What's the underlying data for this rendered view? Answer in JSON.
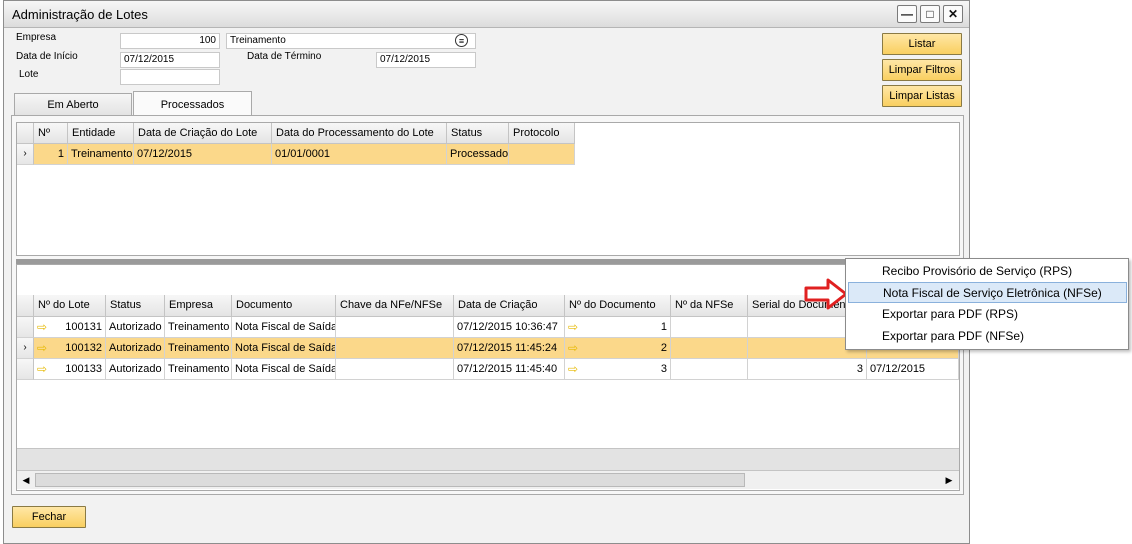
{
  "window": {
    "title": "Administração de Lotes",
    "controls": {
      "minimize": "—",
      "maximize": "□",
      "close": "✕"
    }
  },
  "form": {
    "empresa_label": "Empresa",
    "empresa_value": "100",
    "empresa_name": "Treinamento",
    "data_inicio_label": "Data de Início",
    "data_inicio_value": "07/12/2015",
    "data_termino_label": "Data de Término",
    "data_termino_value": "07/12/2015",
    "lote_label": "Lote",
    "lote_value": ""
  },
  "buttons": {
    "listar": "Listar",
    "limpar_filtros": "Limpar Filtros",
    "limpar_listas": "Limpar Listas",
    "fechar": "Fechar"
  },
  "tabs": [
    {
      "label": "Em Aberto",
      "active": false
    },
    {
      "label": "Processados",
      "active": true
    }
  ],
  "top_grid": {
    "headers": [
      "Nº",
      "Entidade",
      "Data de Criação do Lote",
      "Data do Processamento do Lote",
      "Status",
      "Protocolo"
    ],
    "rows": [
      {
        "num": "1",
        "entidade": "Treinamento",
        "data_criacao": "07/12/2015",
        "data_processamento": "01/01/0001",
        "status": "Processado",
        "protocolo": ""
      }
    ]
  },
  "bottom_grid": {
    "headers": [
      "Nº do Lote",
      "Status",
      "Empresa",
      "Documento",
      "Chave da NFe/NFSe",
      "Data de Criação",
      "Nº do Documento",
      "Nº da NFSe",
      "Serial do Documento",
      ""
    ],
    "rows": [
      {
        "lote": "100131",
        "status": "Autorizado",
        "empresa": "Treinamento",
        "documento": "Nota Fiscal de Saída",
        "chave": "",
        "data": "07/12/2015 10:36:47",
        "num_doc": "1",
        "num_nfse": "",
        "serial": "",
        "extra": ""
      },
      {
        "lote": "100132",
        "status": "Autorizado",
        "empresa": "Treinamento",
        "documento": "Nota Fiscal de Saída",
        "chave": "",
        "data": "07/12/2015 11:45:24",
        "num_doc": "2",
        "num_nfse": "",
        "serial": "",
        "extra": ""
      },
      {
        "lote": "100133",
        "status": "Autorizado",
        "empresa": "Treinamento",
        "documento": "Nota Fiscal de Saída",
        "chave": "",
        "data": "07/12/2015 11:45:40",
        "num_doc": "3",
        "num_nfse": "",
        "serial": "3",
        "extra": "07/12/2015"
      }
    ]
  },
  "context_menu": {
    "items": [
      {
        "label": "Recibo Provisório de Serviço (RPS)",
        "highlighted": false
      },
      {
        "label": "Nota Fiscal de Serviço Eletrônica (NFSe)",
        "highlighted": true
      },
      {
        "label": "Exportar para PDF (RPS)",
        "highlighted": false
      },
      {
        "label": "Exportar para PDF (NFSe)",
        "highlighted": false
      }
    ]
  },
  "colors": {
    "selected_row": "#fbd88a",
    "button_yellow": "#f9cf60",
    "annotation_arrow": "#e02020"
  }
}
